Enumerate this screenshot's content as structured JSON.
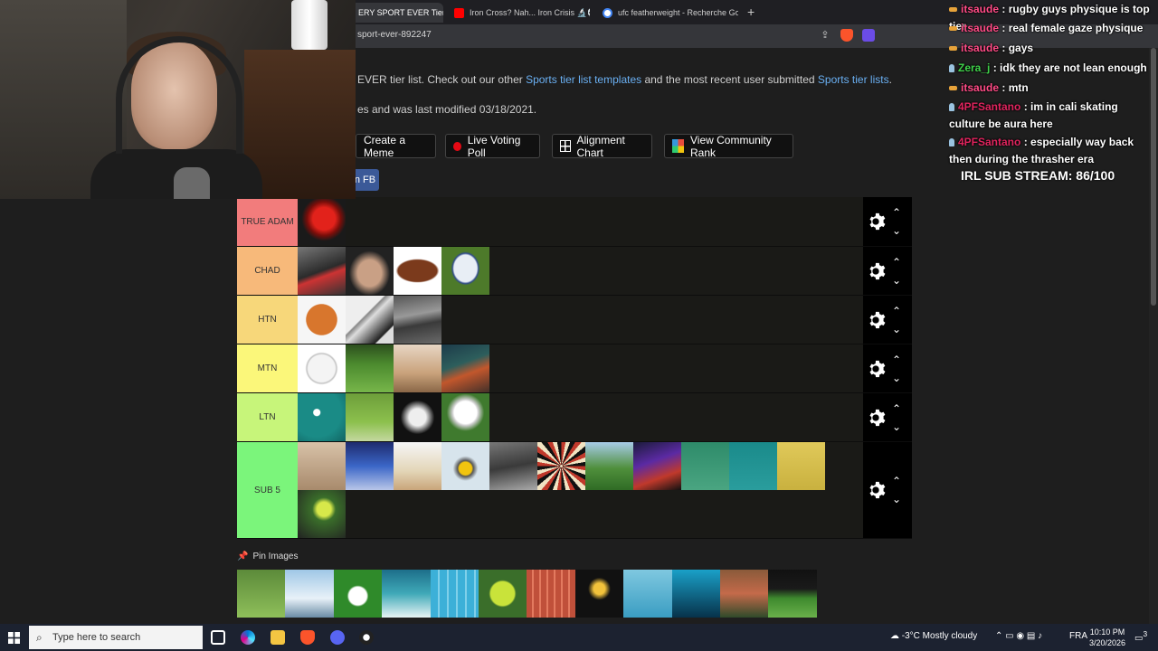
{
  "browser": {
    "tabs": [
      {
        "label": "ERY SPORT EVER Tier",
        "active": true,
        "icon_color": "#f5a623"
      },
      {
        "label": "Iron Cross? Nah... Iron Crisis 🔬💀 #",
        "active": false,
        "icon_color": "#ff0000"
      },
      {
        "label": "ufc featherweight - Recherche Googl",
        "active": false,
        "icon_color": "#4285f4"
      }
    ],
    "url": "sport-ever-892247"
  },
  "page": {
    "desc_line1_prefix": "EVER tier list. Check out our other ",
    "desc_link1": "Sports tier list templates",
    "desc_line1_mid": " and the most recent user submitted ",
    "desc_link2": "Sports tier lists",
    "desc_line1_suffix": ".",
    "desc_line2": "es and was last modified 03/18/2021.",
    "buttons": {
      "create_meme": "Create a Meme",
      "live_voting": "Live Voting Poll",
      "alignment": "Alignment Chart",
      "community": "View Community Rank",
      "fb": "n FB"
    },
    "pin_images_label": "Pin Images"
  },
  "tiers": [
    {
      "label": "TRUE ADAM",
      "color": "#f27c7c"
    },
    {
      "label": "CHAD",
      "color": "#f7b97a"
    },
    {
      "label": "HTN",
      "color": "#f7d77a"
    },
    {
      "label": "MTN",
      "color": "#fbf77a"
    },
    {
      "label": "LTN",
      "color": "#c7f57a"
    },
    {
      "label": "SUB 5",
      "color": "#7bf57b"
    }
  ],
  "chat": [
    {
      "user": "itsaude",
      "text": "rugby guys physique is top tier"
    },
    {
      "user": "itsaude",
      "text": "real female gaze physique"
    },
    {
      "user": "itsaude",
      "text": "gays"
    },
    {
      "user": "Zera_j",
      "text": "idk they are not lean enough"
    },
    {
      "user": "itsaude",
      "text": "mtn"
    },
    {
      "user": "4PFSantano",
      "text": "im in cali skating culture be aura here"
    },
    {
      "user": "4PFSantano",
      "text": "especially way back then during the thrasher era"
    }
  ],
  "sub_stream": "IRL SUB STREAM: 86/100",
  "taskbar": {
    "search_placeholder": "Type here to search",
    "weather": "-3°C  Mostly cloudy",
    "lang": "FRA",
    "time": "10:10 PM",
    "date": "3/20/2026",
    "notif": "3"
  }
}
